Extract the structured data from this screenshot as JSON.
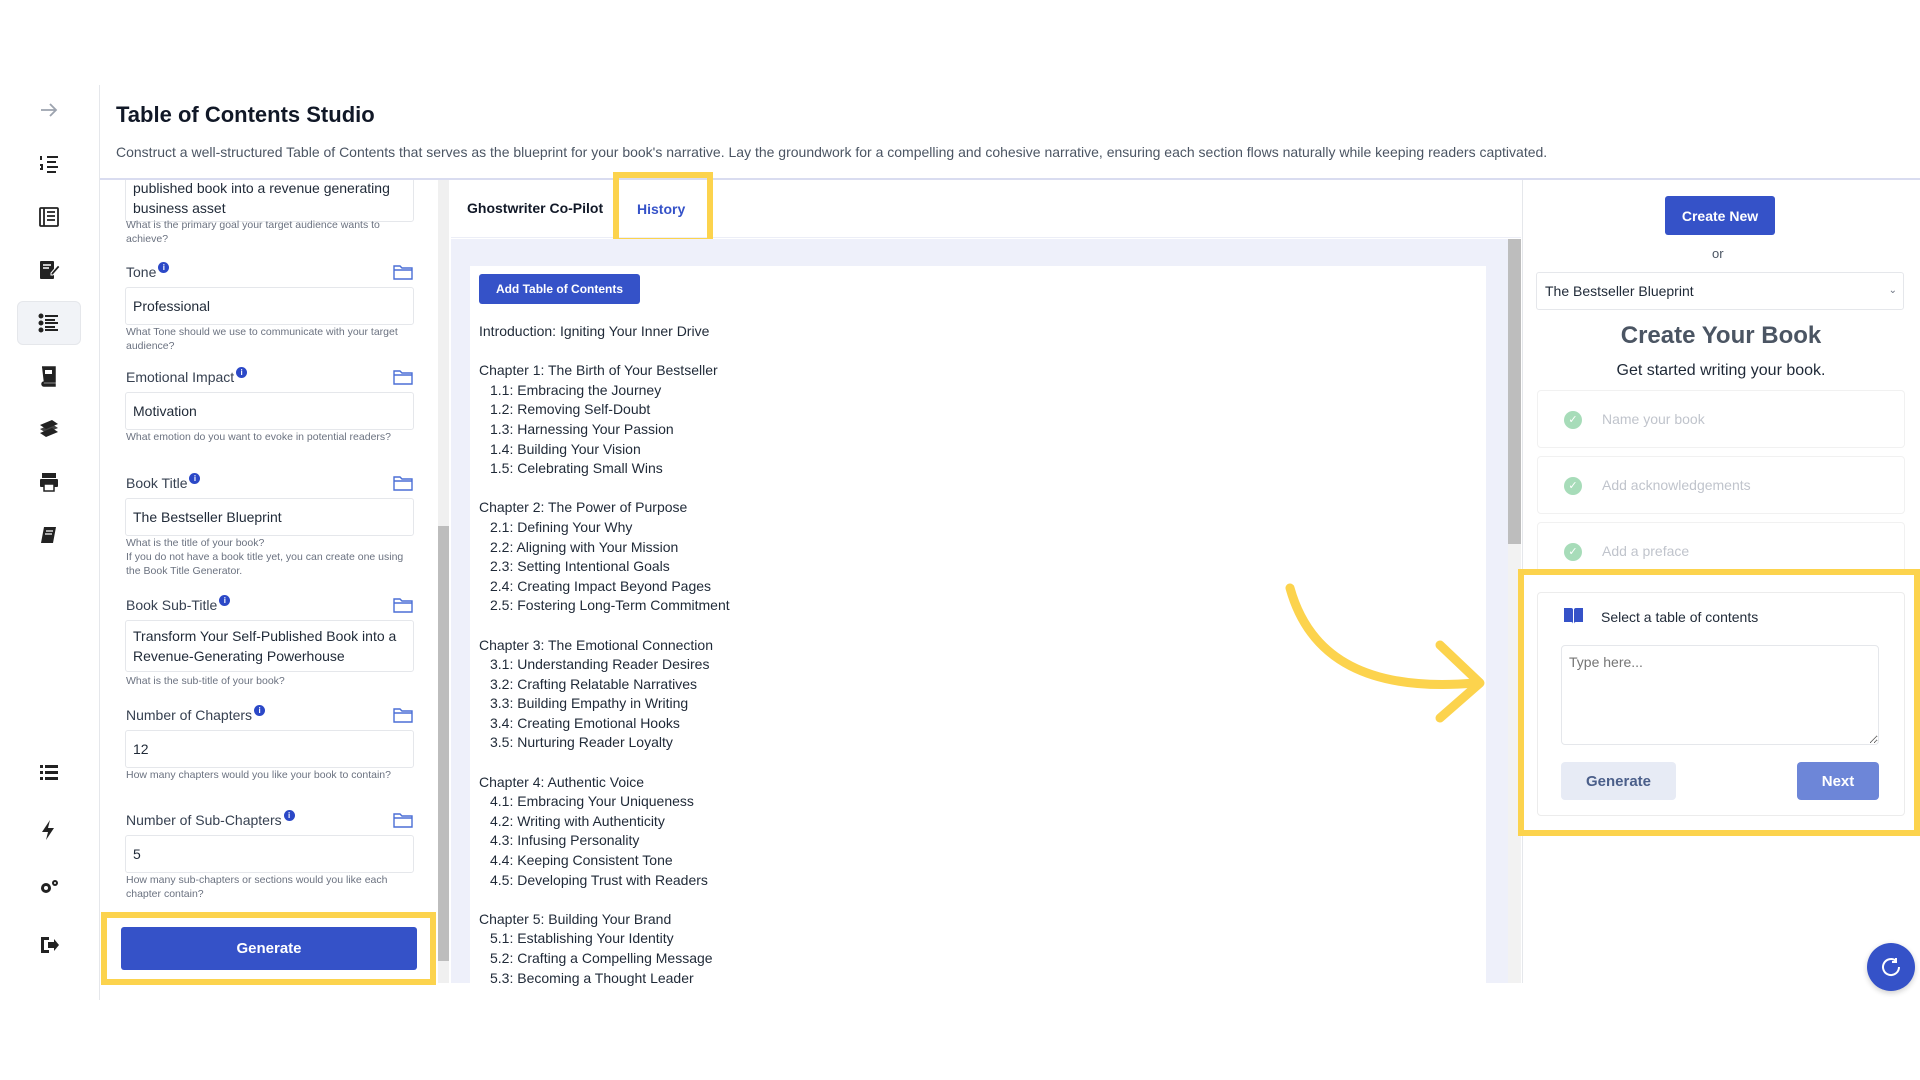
{
  "page": {
    "title": "Table of Contents Studio",
    "description": "Construct a well-structured Table of Contents that serves as the blueprint for your book's narrative. Lay the groundwork for a compelling and cohesive narrative, ensuring each section flows naturally while keeping readers captivated."
  },
  "rail": {
    "icons": [
      "arrow-right-icon",
      "ordered-list-icon",
      "book-list-icon",
      "edit-document-icon",
      "toc-list-icon",
      "book-cover-icon",
      "books-stack-icon",
      "printer-icon",
      "book-icon",
      "list-icon",
      "bolt-icon",
      "settings-icon",
      "logout-icon"
    ],
    "active": "toc-list-icon"
  },
  "form": {
    "goal_value": "published book into a revenue generating business asset",
    "goal_help": "What is the primary goal your target audience wants to achieve?",
    "tone_label": "Tone",
    "tone_value": "Professional",
    "tone_help": "What Tone should we use to communicate with your target audience?",
    "emotion_label": "Emotional Impact",
    "emotion_value": "Motivation",
    "emotion_help": "What emotion do you want to evoke in potential readers?",
    "title_label": "Book Title",
    "title_value": "The Bestseller Blueprint",
    "title_help": "What is the title of your book?\nIf you do not have a book title yet, you can create one using the Book Title Generator.",
    "subtitle_label": "Book Sub-Title",
    "subtitle_value": "Transform Your Self-Published Book into a Revenue-Generating Powerhouse",
    "subtitle_help": "What is the sub-title of your book?",
    "chapters_label": "Number of Chapters",
    "chapters_value": "12",
    "chapters_help": "How many chapters would you like your book to contain?",
    "subchapters_label": "Number of Sub-Chapters",
    "subchapters_value": "5",
    "subchapters_help": "How many sub-chapters or sections would you like each chapter contain?",
    "generate_label": "Generate"
  },
  "middle": {
    "tab_copilot": "Ghostwriter Co-Pilot",
    "tab_history": "History",
    "add_toc_label": "Add Table of Contents",
    "toc": [
      {
        "heading": "Introduction: Igniting Your Inner Drive",
        "items": []
      },
      {
        "heading": "Chapter 1: The Birth of Your Bestseller",
        "items": [
          "1.1: Embracing the Journey",
          "1.2: Removing Self-Doubt",
          "1.3: Harnessing Your Passion",
          "1.4: Building Your Vision",
          "1.5: Celebrating Small Wins"
        ]
      },
      {
        "heading": "Chapter 2: The Power of Purpose",
        "items": [
          "2.1: Defining Your Why",
          "2.2: Aligning with Your Mission",
          "2.3: Setting Intentional Goals",
          "2.4: Creating Impact Beyond Pages",
          "2.5: Fostering Long-Term Commitment"
        ]
      },
      {
        "heading": "Chapter 3: The Emotional Connection",
        "items": [
          "3.1: Understanding Reader Desires",
          "3.2: Crafting Relatable Narratives",
          "3.3: Building Empathy in Writing",
          "3.4: Creating Emotional Hooks",
          "3.5: Nurturing Reader Loyalty"
        ]
      },
      {
        "heading": "Chapter 4: Authentic Voice",
        "items": [
          "4.1: Embracing Your Uniqueness",
          "4.2: Writing with Authenticity",
          "4.3: Infusing Personality",
          "4.4: Keeping Consistent Tone",
          "4.5: Developing Trust with Readers"
        ]
      },
      {
        "heading": "Chapter 5: Building Your Brand",
        "items": [
          "5.1: Establishing Your Identity",
          "5.2: Crafting a Compelling Message",
          "5.3: Becoming a Thought Leader"
        ]
      }
    ]
  },
  "right": {
    "create_new_label": "Create New",
    "or_text": "or",
    "selected_book": "The Bestseller Blueprint",
    "heading": "Create Your Book",
    "subheading": "Get started writing your book.",
    "steps": [
      "Name your book",
      "Add acknowledgements",
      "Add a preface"
    ],
    "card_title": "Select a table of contents",
    "textarea_placeholder": "Type here...",
    "generate_label": "Generate",
    "next_label": "Next"
  },
  "colors": {
    "primary": "#3552c8",
    "highlight": "#fcd34d",
    "step_check": "#a7dcb9"
  }
}
